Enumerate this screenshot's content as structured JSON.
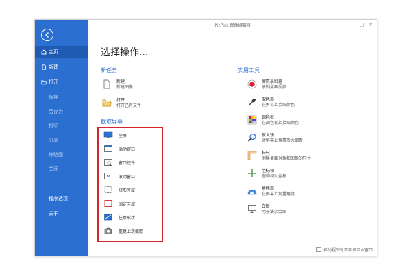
{
  "window": {
    "title": "PicPick 图像编辑器"
  },
  "sidebar": {
    "items": [
      {
        "label": "主页",
        "icon": "home-icon"
      },
      {
        "label": "新建",
        "icon": "new-file-icon"
      },
      {
        "label": "打开",
        "icon": "open-folder-icon"
      },
      {
        "label": "保存"
      },
      {
        "label": "另存为"
      },
      {
        "label": "打印"
      },
      {
        "label": "分享"
      },
      {
        "label": "缩略图"
      },
      {
        "label": "关闭"
      },
      {
        "label": "程序选项"
      },
      {
        "label": "关于"
      }
    ]
  },
  "main": {
    "heading": "选择操作...",
    "new_task": {
      "label": "新任务",
      "items": [
        {
          "title": "新建",
          "subtitle": "新建图像"
        },
        {
          "title": "打开",
          "subtitle": "打开已有文件"
        }
      ]
    },
    "capture": {
      "label": "截取屏幕",
      "items": [
        {
          "label": "全屏",
          "icon": "fullscreen-icon"
        },
        {
          "label": "活动窗口",
          "icon": "active-window-icon"
        },
        {
          "label": "窗口控件",
          "icon": "window-control-icon"
        },
        {
          "label": "滚动窗口",
          "icon": "scroll-window-icon"
        },
        {
          "label": "矩形区域",
          "icon": "rect-region-icon"
        },
        {
          "label": "固定区域",
          "icon": "fixed-region-icon"
        },
        {
          "label": "任意形状",
          "icon": "freehand-icon"
        },
        {
          "label": "重复上次截取",
          "icon": "repeat-capture-icon"
        }
      ]
    },
    "tools": {
      "label": "实用工具",
      "items": [
        {
          "title": "屏幕录制器",
          "subtitle": "录制桌面视频",
          "icon": "record-icon"
        },
        {
          "title": "取色器",
          "subtitle": "在屏幕上拾取颜色",
          "icon": "eyedropper-icon"
        },
        {
          "title": "调色板",
          "subtitle": "在调色板上拾取颜色",
          "icon": "palette-icon"
        },
        {
          "title": "放大镜",
          "subtitle": "对屏幕上像素放大细看",
          "icon": "magnifier-icon"
        },
        {
          "title": "标尺",
          "subtitle": "测量桌面对象和图像的尺寸",
          "icon": "ruler-icon"
        },
        {
          "title": "坐标轴",
          "subtitle": "查询相对坐标",
          "icon": "crosshair-icon"
        },
        {
          "title": "量角器",
          "subtitle": "在屏幕上测量角度",
          "icon": "protractor-icon"
        },
        {
          "title": "白板",
          "subtitle": "用于演示绘图",
          "icon": "whiteboard-icon"
        }
      ]
    },
    "footer": {
      "checkbox_label": "启动程序时不再显示本窗口"
    }
  },
  "colors": {
    "accent": "#2b6fd0",
    "highlight": "#d8232a"
  }
}
